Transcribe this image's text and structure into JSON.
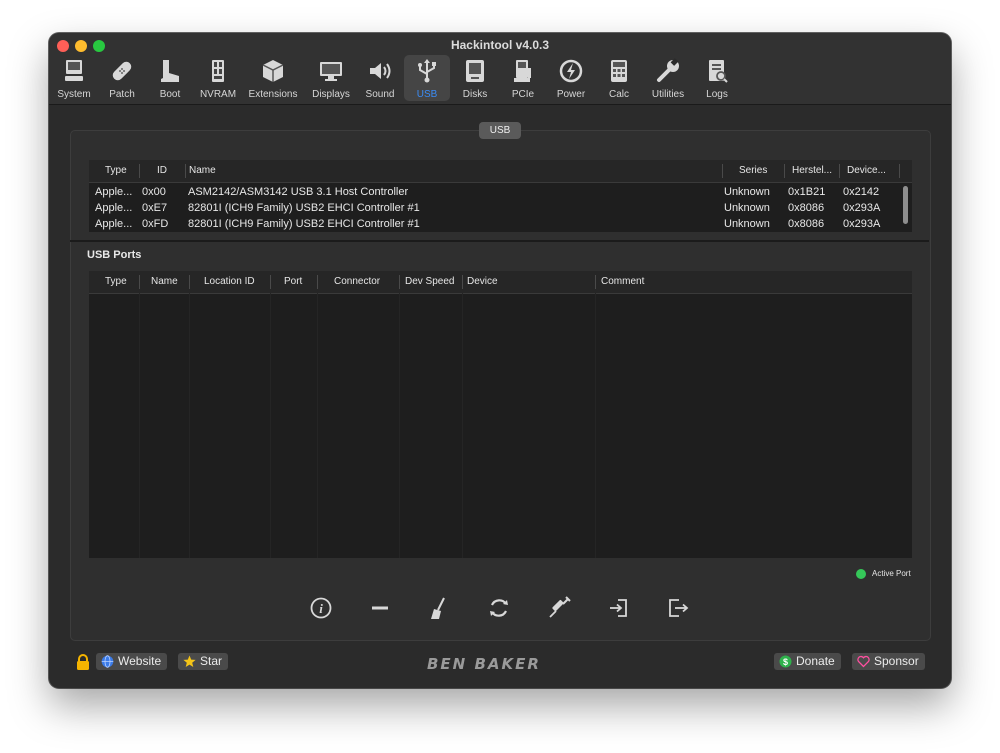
{
  "window": {
    "title": "Hackintool v4.0.3"
  },
  "toolbar": [
    {
      "label": "System"
    },
    {
      "label": "Patch"
    },
    {
      "label": "Boot"
    },
    {
      "label": "NVRAM"
    },
    {
      "label": "Extensions"
    },
    {
      "label": "Displays"
    },
    {
      "label": "Sound"
    },
    {
      "label": "USB"
    },
    {
      "label": "Disks"
    },
    {
      "label": "PCIe"
    },
    {
      "label": "Power"
    },
    {
      "label": "Calc"
    },
    {
      "label": "Utilities"
    },
    {
      "label": "Logs"
    }
  ],
  "selected_tab": "USB",
  "group_label": "USB",
  "controllers": {
    "headers": [
      "Type",
      "ID",
      "Name",
      "Series",
      "Herstel...",
      "Device..."
    ],
    "rows": [
      [
        "Apple...",
        "0x00",
        "ASM2142/ASM3142 USB 3.1 Host Controller",
        "Unknown",
        "0x1B21",
        "0x2142"
      ],
      [
        "Apple...",
        "0xE7",
        "82801I (ICH9 Family) USB2 EHCI Controller #1",
        "Unknown",
        "0x8086",
        "0x293A"
      ],
      [
        "Apple...",
        "0xFD",
        "82801I (ICH9 Family) USB2 EHCI Controller #1",
        "Unknown",
        "0x8086",
        "0x293A"
      ]
    ]
  },
  "ports": {
    "title": "USB Ports",
    "headers": [
      "Type",
      "Name",
      "Location ID",
      "Port",
      "Connector",
      "Dev Speed",
      "Device",
      "Comment"
    ]
  },
  "legend": {
    "label": "Active Port",
    "color": "#35c759"
  },
  "actions": [
    "info-icon",
    "remove-icon",
    "clear-icon",
    "refresh-icon",
    "inject-icon",
    "import-icon",
    "export-icon"
  ],
  "footer": {
    "website": "Website",
    "star": "Star",
    "brand": "BEN BAKER",
    "donate": "Donate",
    "sponsor": "Sponsor"
  },
  "colors": {
    "accent": "#3b8cf5",
    "window_bg": "#2b2b2b",
    "table_bg": "#1e1e1e"
  }
}
